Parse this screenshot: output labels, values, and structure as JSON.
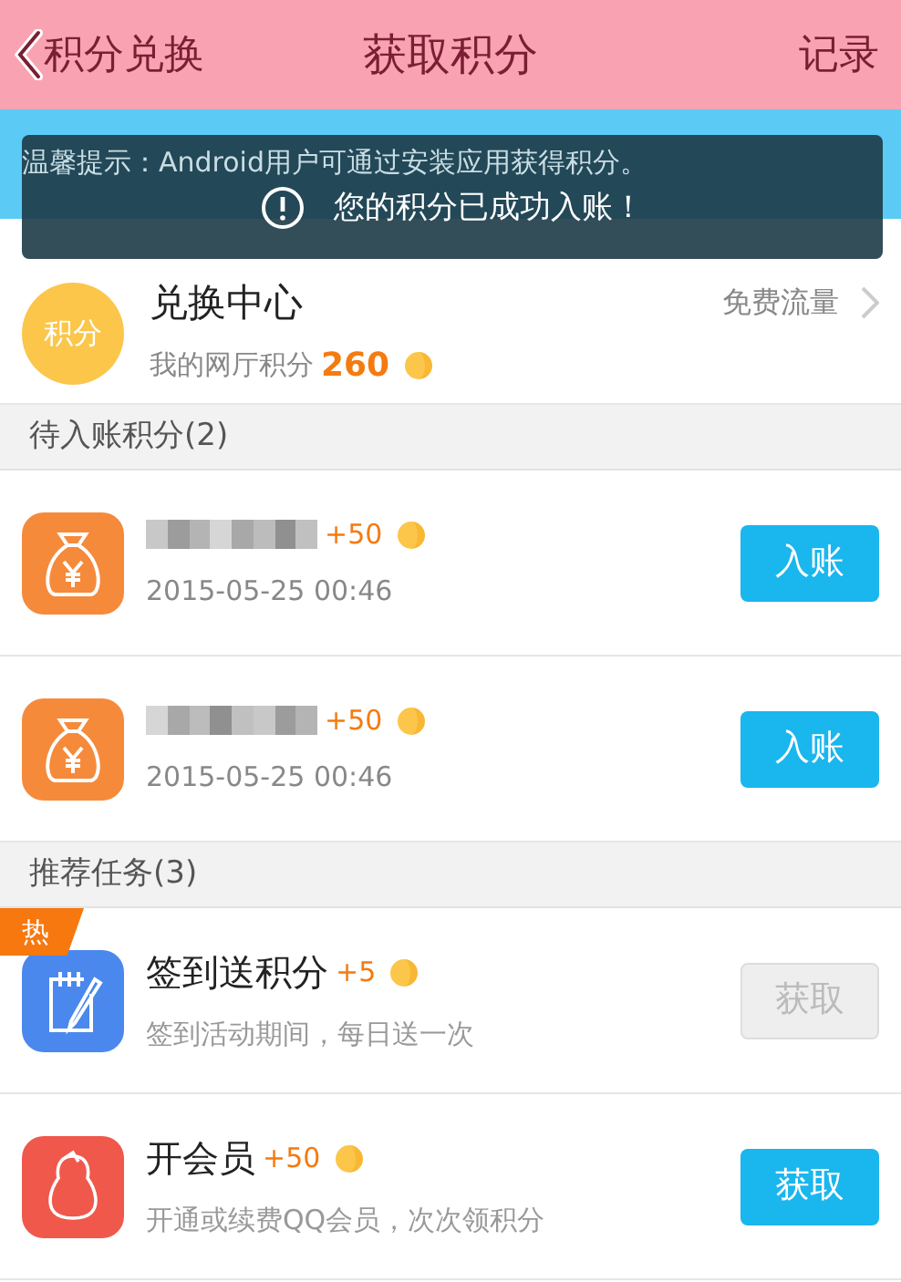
{
  "header": {
    "back_label": "积分兑换",
    "title": "获取积分",
    "right_label": "记录"
  },
  "tip": "温馨提示：Android用户可通过安装应用获得积分。",
  "toast": "您的积分已成功入账！",
  "exchange": {
    "badge": "积分",
    "title": "兑换中心",
    "points_label": "我的网厅积分",
    "points": "260",
    "link": "免费流量"
  },
  "pending": {
    "title": "待入账积分(2)",
    "items": [
      {
        "reward": "+50",
        "time": "2015-05-25 00:46",
        "button": "入账"
      },
      {
        "reward": "+50",
        "time": "2015-05-25 00:46",
        "button": "入账"
      }
    ]
  },
  "tasks": {
    "title": "推荐任务(3)",
    "items": [
      {
        "kind": "checkin",
        "hot": "热",
        "name": "签到送积分",
        "reward": "+5",
        "desc": "签到活动期间，每日送一次",
        "button": "获取",
        "disabled": true
      },
      {
        "kind": "vip",
        "name": "开会员",
        "reward": "+50",
        "desc": "开通或续费QQ会员，次次领积分",
        "button": "获取",
        "disabled": false
      }
    ]
  }
}
